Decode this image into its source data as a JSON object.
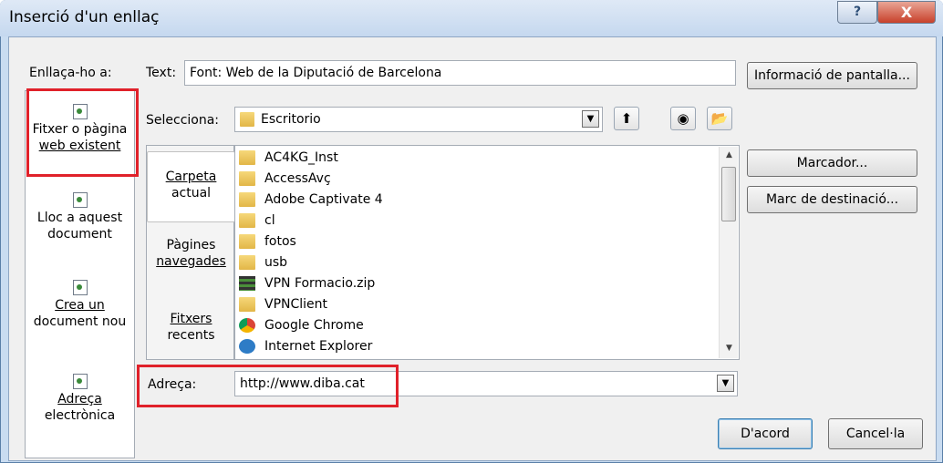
{
  "window": {
    "title": "Inserció d'un enllaç",
    "help_glyph": "?",
    "close_glyph": "X"
  },
  "link_to": {
    "label": "Enllaça-ho a:",
    "items": [
      {
        "line1": "Fitxer o pàgina",
        "line2": "web existent"
      },
      {
        "line1": "Lloc a aquest",
        "line2": "document"
      },
      {
        "line1": "Crea un",
        "line2": "document nou"
      },
      {
        "line1": "Adreça",
        "line2": "electrònica"
      }
    ]
  },
  "text_field": {
    "label": "Text:",
    "value": "Font: Web de la Diputació de Barcelona"
  },
  "screen_tip_button": "Informació de pantalla...",
  "look_in": {
    "label": "Selecciona:",
    "value": "Escritorio"
  },
  "browse_tabs": [
    {
      "line1": "Carpeta",
      "line2": "actual"
    },
    {
      "line1": "Pàgines",
      "line2": "navegades"
    },
    {
      "line1": "Fitxers",
      "line2": "recents"
    }
  ],
  "files": [
    {
      "name": "AC4KG_Inst",
      "icon": "folder-icon"
    },
    {
      "name": "AccessAvç",
      "icon": "folder-icon"
    },
    {
      "name": "Adobe Captivate 4",
      "icon": "folder-icon"
    },
    {
      "name": "cl",
      "icon": "folder-icon"
    },
    {
      "name": "fotos",
      "icon": "folder-icon"
    },
    {
      "name": "usb",
      "icon": "folder-icon"
    },
    {
      "name": "VPN Formacio.zip",
      "icon": "zip-archive-icon"
    },
    {
      "name": "VPNClient",
      "icon": "folder-icon"
    },
    {
      "name": "Google Chrome",
      "icon": "chrome-icon"
    },
    {
      "name": "Internet Explorer",
      "icon": "internet-explorer-icon"
    }
  ],
  "bookmark_button": "Marcador...",
  "target_frame_button": "Marc de destinació...",
  "address": {
    "label": "Adreça:",
    "value": "http://www.diba.cat"
  },
  "ok_button": "D'acord",
  "cancel_button": "Cancel·la",
  "colors": {
    "highlight_box": "#e0212a",
    "title_bar": "#c5d8ef",
    "close": "#c8412b"
  }
}
